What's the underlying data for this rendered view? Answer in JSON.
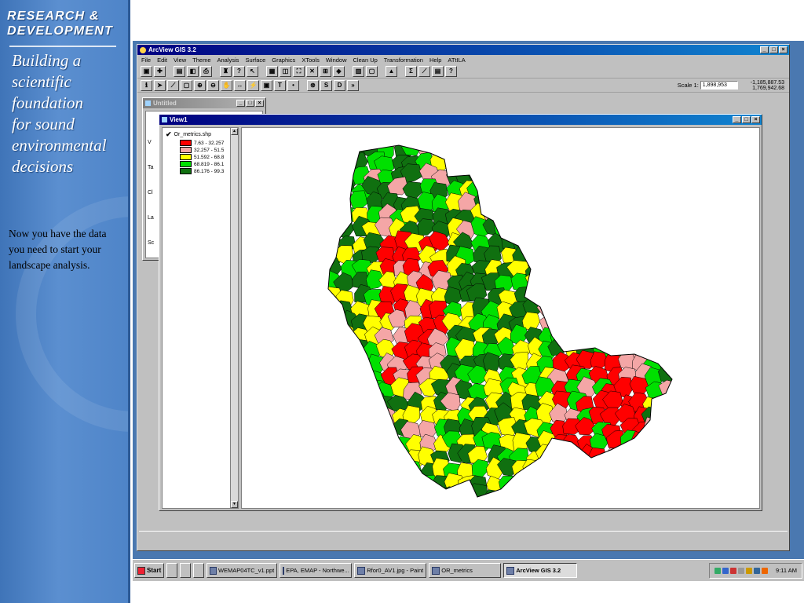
{
  "slide": {
    "org_title_line1": "RESEARCH &",
    "org_title_line2": "DEVELOPMENT",
    "tagline": [
      "Building a",
      "scientific",
      "foundation",
      "for sound",
      "environmental",
      "decisions"
    ],
    "note": "Now you have the data you need to start your landscape analysis."
  },
  "app": {
    "title": "ArcView GIS 3.2",
    "menu": [
      "File",
      "Edit",
      "View",
      "Theme",
      "Analysis",
      "Surface",
      "Graphics",
      "XTools",
      "Window",
      "Clean Up",
      "Transformation",
      "Help",
      "ATtILA"
    ],
    "scale_label": "Scale 1:",
    "scale_value": "1,898,953",
    "coord_x": "-1,185,887.53",
    "coord_y": "1,769,942.68"
  },
  "untitled_window": {
    "title": "Untitled",
    "side_labels": [
      "V",
      "Ta",
      "Cl",
      "La",
      "Sc"
    ]
  },
  "view_window": {
    "title": "View1",
    "theme_name": "Or_metrics.shp",
    "theme_checked": true,
    "legend": [
      {
        "label": "7.63 - 32.257",
        "color": "#ff0000"
      },
      {
        "label": "32.257 - 51.5",
        "color": "#f4a6a6"
      },
      {
        "label": "51.592 - 68.8",
        "color": "#ffff00"
      },
      {
        "label": "68.819 - 86.1",
        "color": "#00e000"
      },
      {
        "label": "86.176 - 99.3",
        "color": "#107010"
      }
    ]
  },
  "taskbar": {
    "start_label": "Start",
    "items": [
      "WEMAP04TC_v1.ppt",
      "EPA, EMAP - Northwe...",
      "Rfor0_AV1.jpg - Paint",
      "OR_metrics",
      "ArcView GIS 3.2"
    ],
    "active_item": "ArcView GIS 3.2",
    "clock": "9:11 AM"
  },
  "colors": {
    "title_active": "#000080",
    "desktop": "#4a78b0",
    "sidebar_blue": "#4e84c8"
  },
  "icons": [
    "identify-icon",
    "pointer-icon",
    "vertex-icon",
    "zoom-in-icon",
    "zoom-out-icon",
    "pan-icon",
    "measure-icon",
    "text-icon",
    "draw-point-icon"
  ]
}
